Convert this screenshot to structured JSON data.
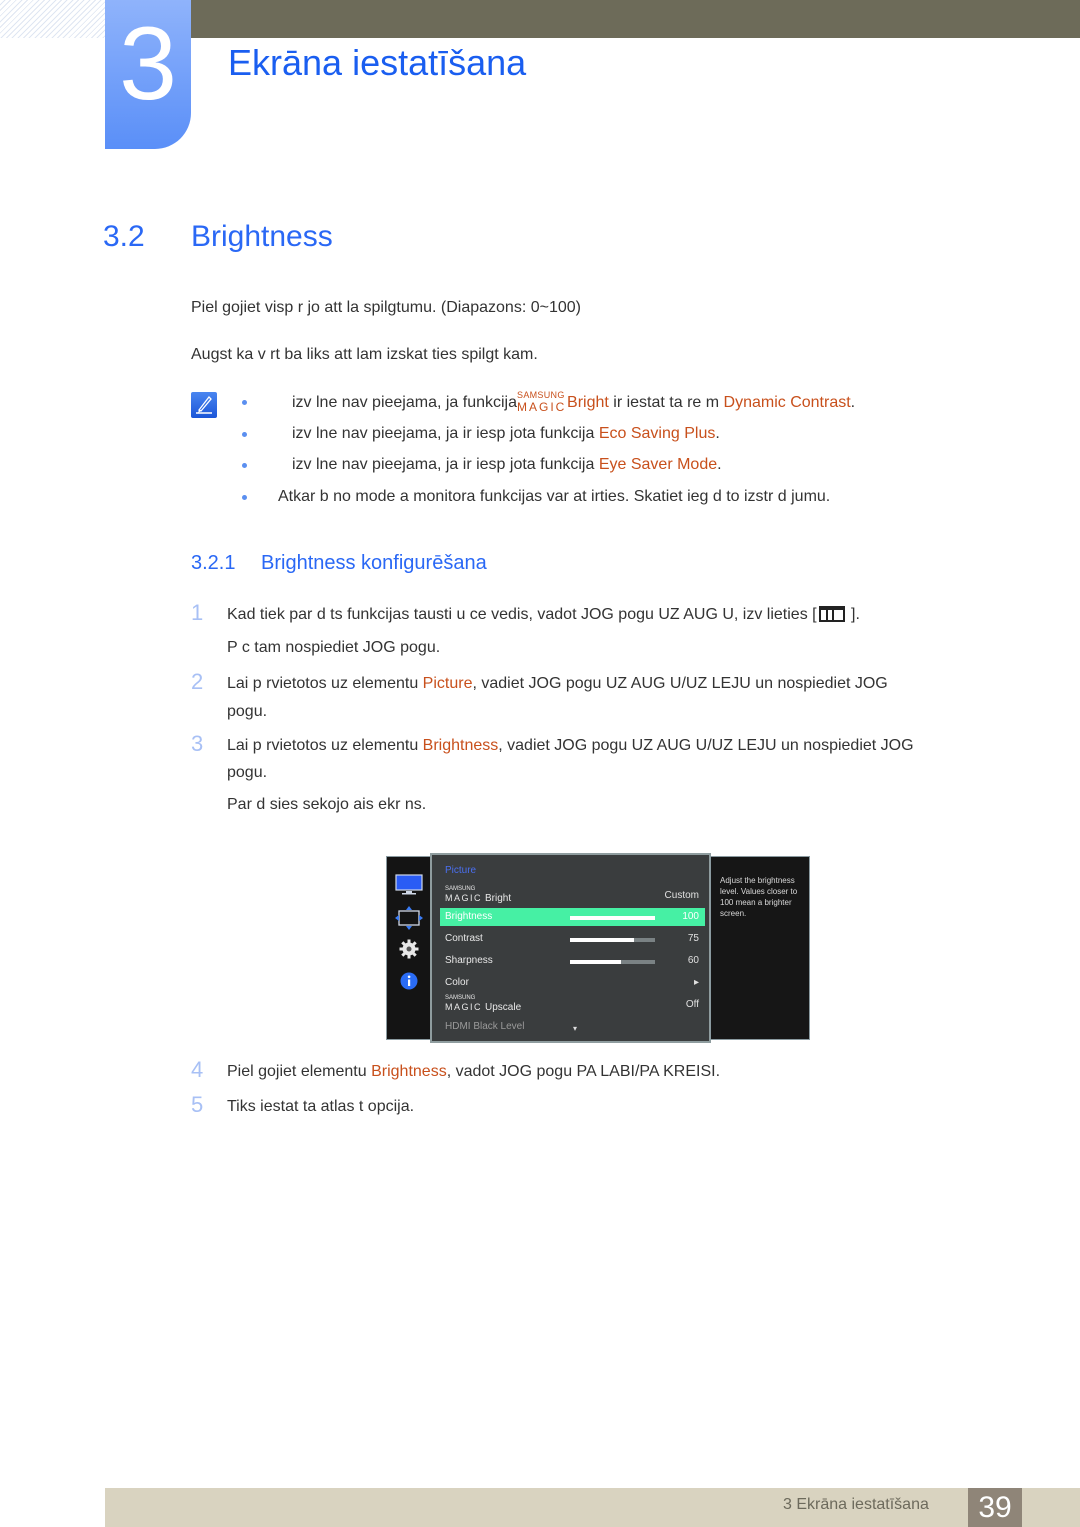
{
  "chapter": {
    "number": "3",
    "title": "Ekrāna iestatīšana"
  },
  "section": {
    "number": "3.2",
    "title": "Brightness"
  },
  "intro": [
    "Piel gojiet visp r jo att la spilgtumu. (Diapazons: 0~100)",
    "Augst ka v rt ba liks att  lam izskat ties spilgt kam."
  ],
  "notes": [
    {
      "pre": "izv lne nav pieejama, ja funkcija",
      "magic_top": "SAMSUNG",
      "magic_bottom": "MAGIC",
      "magic_word": "Bright",
      "mid": " ir iestat ta re  m  ",
      "link": "Dynamic Contrast",
      "post": "."
    },
    {
      "pre": "izv lne nav pieejama, ja ir iesp jota funkcija ",
      "link": "Eco Saving Plus",
      "post": "."
    },
    {
      "pre": "izv lne nav pieejama, ja ir iesp jota funkcija ",
      "link": "Eye Saver Mode",
      "post": "."
    },
    {
      "text": "Atkar b  no mode a monitora funkcijas var at  irties. Skatiet ieg d to izstr d jumu."
    }
  ],
  "subsection": {
    "number": "3.2.1",
    "title": "Brightness konfigurēšana"
  },
  "steps": [
    {
      "num": "1",
      "line1": "Kad tiek par d ts funkcijas tausti u ce vedis, vadot JOG pogu UZ AUG U, izv lieties [",
      "line1_end": " ].",
      "line2": "P c tam nospiediet JOG pogu."
    },
    {
      "num": "2",
      "pre": "Lai p rvietotos uz elementu ",
      "link": "Picture",
      "post": ", vadiet JOG pogu UZ AUG U/UZ LEJU un nospiediet JOG",
      "line2": "pogu."
    },
    {
      "num": "3",
      "pre": "Lai p rvietotos uz elementu ",
      "link": "Brightness",
      "post": ", vadiet JOG pogu UZ AUG U/UZ LEJU un nospiediet JOG",
      "line2": "pogu.",
      "line3": "Par d sies sekojo ais ekr ns."
    },
    {
      "num": "4",
      "pre": "Piel gojiet elementu ",
      "link": "Brightness",
      "post": ", vadot JOG pogu PA LABI/PA KREISI."
    },
    {
      "num": "5",
      "text": "Tiks iestat ta atlas t  opcija."
    }
  ],
  "osd": {
    "header": "Picture",
    "magic_top": "SAMSUNG",
    "magic_bottom": "MAGIC",
    "rows": [
      {
        "label": "Bright",
        "magic": true,
        "value": "Custom"
      },
      {
        "label": "Brightness",
        "value": "100",
        "level": 100,
        "selected": true
      },
      {
        "label": "Contrast",
        "value": "75",
        "level": 75
      },
      {
        "label": "Sharpness",
        "value": "60",
        "level": 60
      },
      {
        "label": "Color",
        "value": "▸"
      },
      {
        "label": "Upscale",
        "magic": true,
        "value": "Off"
      },
      {
        "label": "HDMI Black Level",
        "value": "▾",
        "dim": true
      }
    ],
    "help": "Adjust the brightness level. Values closer to 100 mean a brighter screen.",
    "icons": [
      "monitor-icon",
      "resize-icon",
      "gear-icon",
      "info-icon"
    ]
  },
  "footer": {
    "chapter_label": "3 Ekrāna iestatīšana",
    "page": "39"
  },
  "colors": {
    "accent_blue": "#2a68f5",
    "link_red": "#c8501c",
    "osd_highlight": "#46f0a4"
  }
}
